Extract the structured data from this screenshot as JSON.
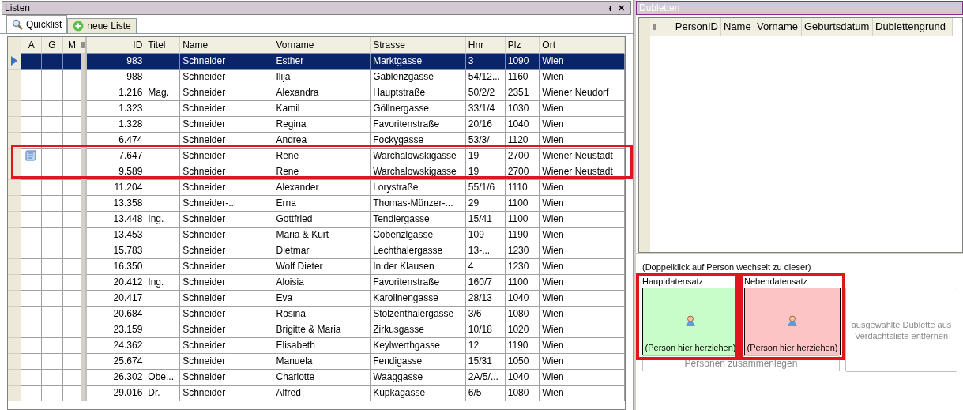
{
  "lists_panel": {
    "title": "Listen",
    "pin": "ᵼ",
    "close": "✕",
    "tabs": [
      {
        "label": "Quicklist",
        "selected": true,
        "kind": "search"
      },
      {
        "label": "neue Liste",
        "selected": false,
        "kind": "add"
      }
    ],
    "table": {
      "columns": [
        "A",
        "G",
        "M",
        "ID",
        "Titel",
        "Name",
        "Vorname",
        "Strasse",
        "Hnr",
        "Plz",
        "Ort"
      ],
      "rows": [
        {
          "selected": true,
          "has_note": false,
          "cells": [
            "",
            "",
            "",
            "983",
            "",
            "Schneider",
            "Esther",
            "Marktgasse",
            "3",
            "1090",
            "Wien"
          ]
        },
        {
          "selected": false,
          "has_note": false,
          "cells": [
            "",
            "",
            "",
            "988",
            "",
            "Schneider",
            "Ilija",
            "Gablenzgasse",
            "54/12...",
            "1160",
            "Wien"
          ]
        },
        {
          "selected": false,
          "has_note": false,
          "cells": [
            "",
            "",
            "",
            "1.216",
            "Mag.",
            "Schneider",
            "Alexandra",
            "Hauptstraße",
            "50/2/2",
            "2351",
            "Wiener Neudorf"
          ]
        },
        {
          "selected": false,
          "has_note": false,
          "cells": [
            "",
            "",
            "",
            "1.323",
            "",
            "Schneider",
            "Kamil",
            "Göllnergasse",
            "33/1/4",
            "1030",
            "Wien"
          ]
        },
        {
          "selected": false,
          "has_note": false,
          "cells": [
            "",
            "",
            "",
            "1.328",
            "",
            "Schneider",
            "Regina",
            "Favoritenstraße",
            "20/16",
            "1040",
            "Wien"
          ]
        },
        {
          "selected": false,
          "has_note": false,
          "cells": [
            "",
            "",
            "",
            "6.474",
            "",
            "Schneider",
            "Andrea",
            "Fockygasse",
            "53/3/",
            "1120",
            "Wien"
          ]
        },
        {
          "selected": false,
          "has_note": true,
          "cells": [
            "",
            "",
            "",
            "7.647",
            "",
            "Schneider",
            "Rene",
            "Warchalowskigasse",
            "19",
            "2700",
            "Wiener Neustadt"
          ]
        },
        {
          "selected": false,
          "has_note": false,
          "cells": [
            "",
            "",
            "",
            "9.589",
            "",
            "Schneider",
            "Rene",
            "Warchalowskigasse",
            "19",
            "2700",
            "Wiener Neustadt"
          ]
        },
        {
          "selected": false,
          "has_note": false,
          "cells": [
            "",
            "",
            "",
            "11.204",
            "",
            "Schneider",
            "Alexander",
            "Lorystraße",
            "55/1/6",
            "1110",
            "Wien"
          ]
        },
        {
          "selected": false,
          "has_note": false,
          "cells": [
            "",
            "",
            "",
            "13.358",
            "",
            "Schneider-...",
            "Erna",
            "Thomas-Münzer-...",
            "29",
            "1100",
            "Wien"
          ]
        },
        {
          "selected": false,
          "has_note": false,
          "cells": [
            "",
            "",
            "",
            "13.448",
            "Ing.",
            "Schneider",
            "Gottfried",
            "Tendlergasse",
            "15/41",
            "1100",
            "Wien"
          ]
        },
        {
          "selected": false,
          "has_note": false,
          "cells": [
            "",
            "",
            "",
            "13.453",
            "",
            "Schneider",
            "Maria & Kurt",
            "Cobenzlgasse",
            "109",
            "1190",
            "Wien"
          ]
        },
        {
          "selected": false,
          "has_note": false,
          "cells": [
            "",
            "",
            "",
            "15.783",
            "",
            "Schneider",
            "Dietmar",
            "Lechthalergasse",
            "13-...",
            "1230",
            "Wien"
          ]
        },
        {
          "selected": false,
          "has_note": false,
          "cells": [
            "",
            "",
            "",
            "16.350",
            "",
            "Schneider",
            "Wolf Dieter",
            "In der Klausen",
            "4",
            "1230",
            "Wien"
          ]
        },
        {
          "selected": false,
          "has_note": false,
          "cells": [
            "",
            "",
            "",
            "20.412",
            "Ing.",
            "Schneider",
            "Aloisia",
            "Favoritenstraße",
            "160/7",
            "1100",
            "Wien"
          ]
        },
        {
          "selected": false,
          "has_note": false,
          "cells": [
            "",
            "",
            "",
            "20.417",
            "",
            "Schneider",
            "Eva",
            "Karolinengasse",
            "28/13",
            "1040",
            "Wien"
          ]
        },
        {
          "selected": false,
          "has_note": false,
          "cells": [
            "",
            "",
            "",
            "20.684",
            "",
            "Schneider",
            "Rosina",
            "Stolzenthalergasse",
            "3/6",
            "1080",
            "Wien"
          ]
        },
        {
          "selected": false,
          "has_note": false,
          "cells": [
            "",
            "",
            "",
            "23.159",
            "",
            "Schneider",
            "Brigitte & Maria",
            "Zirkusgasse",
            "10/18",
            "1020",
            "Wien"
          ]
        },
        {
          "selected": false,
          "has_note": false,
          "cells": [
            "",
            "",
            "",
            "24.362",
            "",
            "Schneider",
            "Elisabeth",
            "Keylwerthgasse",
            "12",
            "1190",
            "Wien"
          ]
        },
        {
          "selected": false,
          "has_note": false,
          "cells": [
            "",
            "",
            "",
            "25.674",
            "",
            "Schneider",
            "Manuela",
            "Fendigasse",
            "15/31",
            "1050",
            "Wien"
          ]
        },
        {
          "selected": false,
          "has_note": false,
          "cells": [
            "",
            "",
            "",
            "26.302",
            "Obe...",
            "Schneider",
            "Charlotte",
            "Waaggasse",
            "2A/5/...",
            "1040",
            "Wien"
          ]
        },
        {
          "selected": false,
          "has_note": false,
          "cells": [
            "",
            "",
            "",
            "29.016",
            "Dr.",
            "Schneider",
            "Alfred",
            "Kupkagasse",
            "6/5",
            "1080",
            "Wien"
          ]
        }
      ]
    }
  },
  "duplicates_panel": {
    "title": "Dubletten",
    "columns": [
      "PersonID",
      "Name",
      "Vorname",
      "Geburtsdatum",
      "Dublettengrund"
    ],
    "hint": "(Doppelklick auf Person wechselt zu dieser)",
    "drop_zones": [
      {
        "label": "Hauptdatensatz",
        "placeholder": "(Person hier herziehen)",
        "color": "#c8fcc8"
      },
      {
        "label": "Nebendatensatz",
        "placeholder": "(Person hier herziehen)",
        "color": "#fcc4c4"
      }
    ],
    "merge_button": {
      "label": "Personen zusammenlegen",
      "disabled": true
    },
    "remove_button": {
      "label": "ausgewählte Dublette aus Verdachtsliste entfernen",
      "disabled": true
    }
  }
}
